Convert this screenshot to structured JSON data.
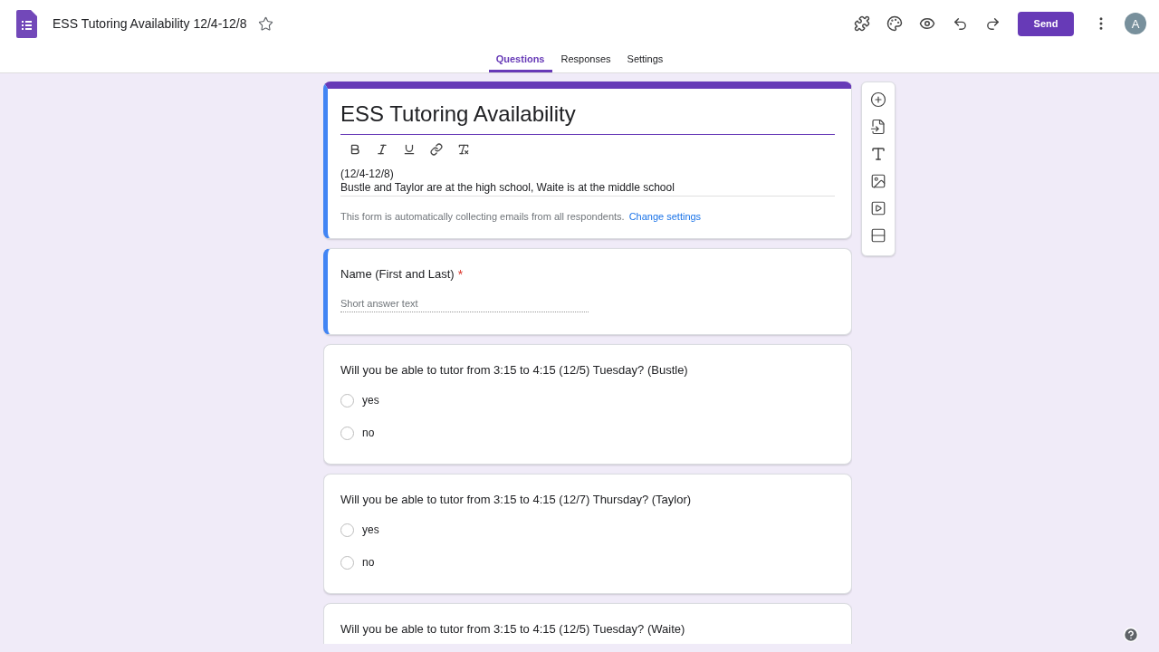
{
  "header": {
    "title": "ESS Tutoring Availability 12/4-12/8",
    "starred": false,
    "send_label": "Send",
    "avatar_letter": "A"
  },
  "tabs": [
    {
      "label": "Questions",
      "selected": true
    },
    {
      "label": "Responses",
      "selected": false
    },
    {
      "label": "Settings",
      "selected": false
    }
  ],
  "form": {
    "title": "ESS Tutoring Availability",
    "description_lines": [
      "(12/4-12/8)",
      "Bustle and Taylor are at the high school, Waite is at the middle school"
    ],
    "email_notice": "This form is automatically collecting emails from all respondents.",
    "email_link": "Change settings"
  },
  "questions": [
    {
      "kind": "short_answer",
      "title": "Name (First and Last)",
      "required_mark": "*",
      "highlighted": true,
      "placeholder": "Short answer text"
    },
    {
      "kind": "multiple_choice",
      "title": "Will you be able to tutor from 3:15 to 4:15 (12/5) Tuesday? (Bustle)",
      "highlighted": false,
      "options": [
        "yes",
        "no"
      ]
    },
    {
      "kind": "multiple_choice",
      "title": "Will you be able to tutor from 3:15 to 4:15 (12/7) Thursday? (Taylor)",
      "highlighted": false,
      "options": [
        "yes",
        "no"
      ]
    },
    {
      "kind": "multiple_choice",
      "title": "Will you be able to tutor from 3:15 to 4:15 (12/5) Tuesday? (Waite)",
      "highlighted": false
    }
  ]
}
